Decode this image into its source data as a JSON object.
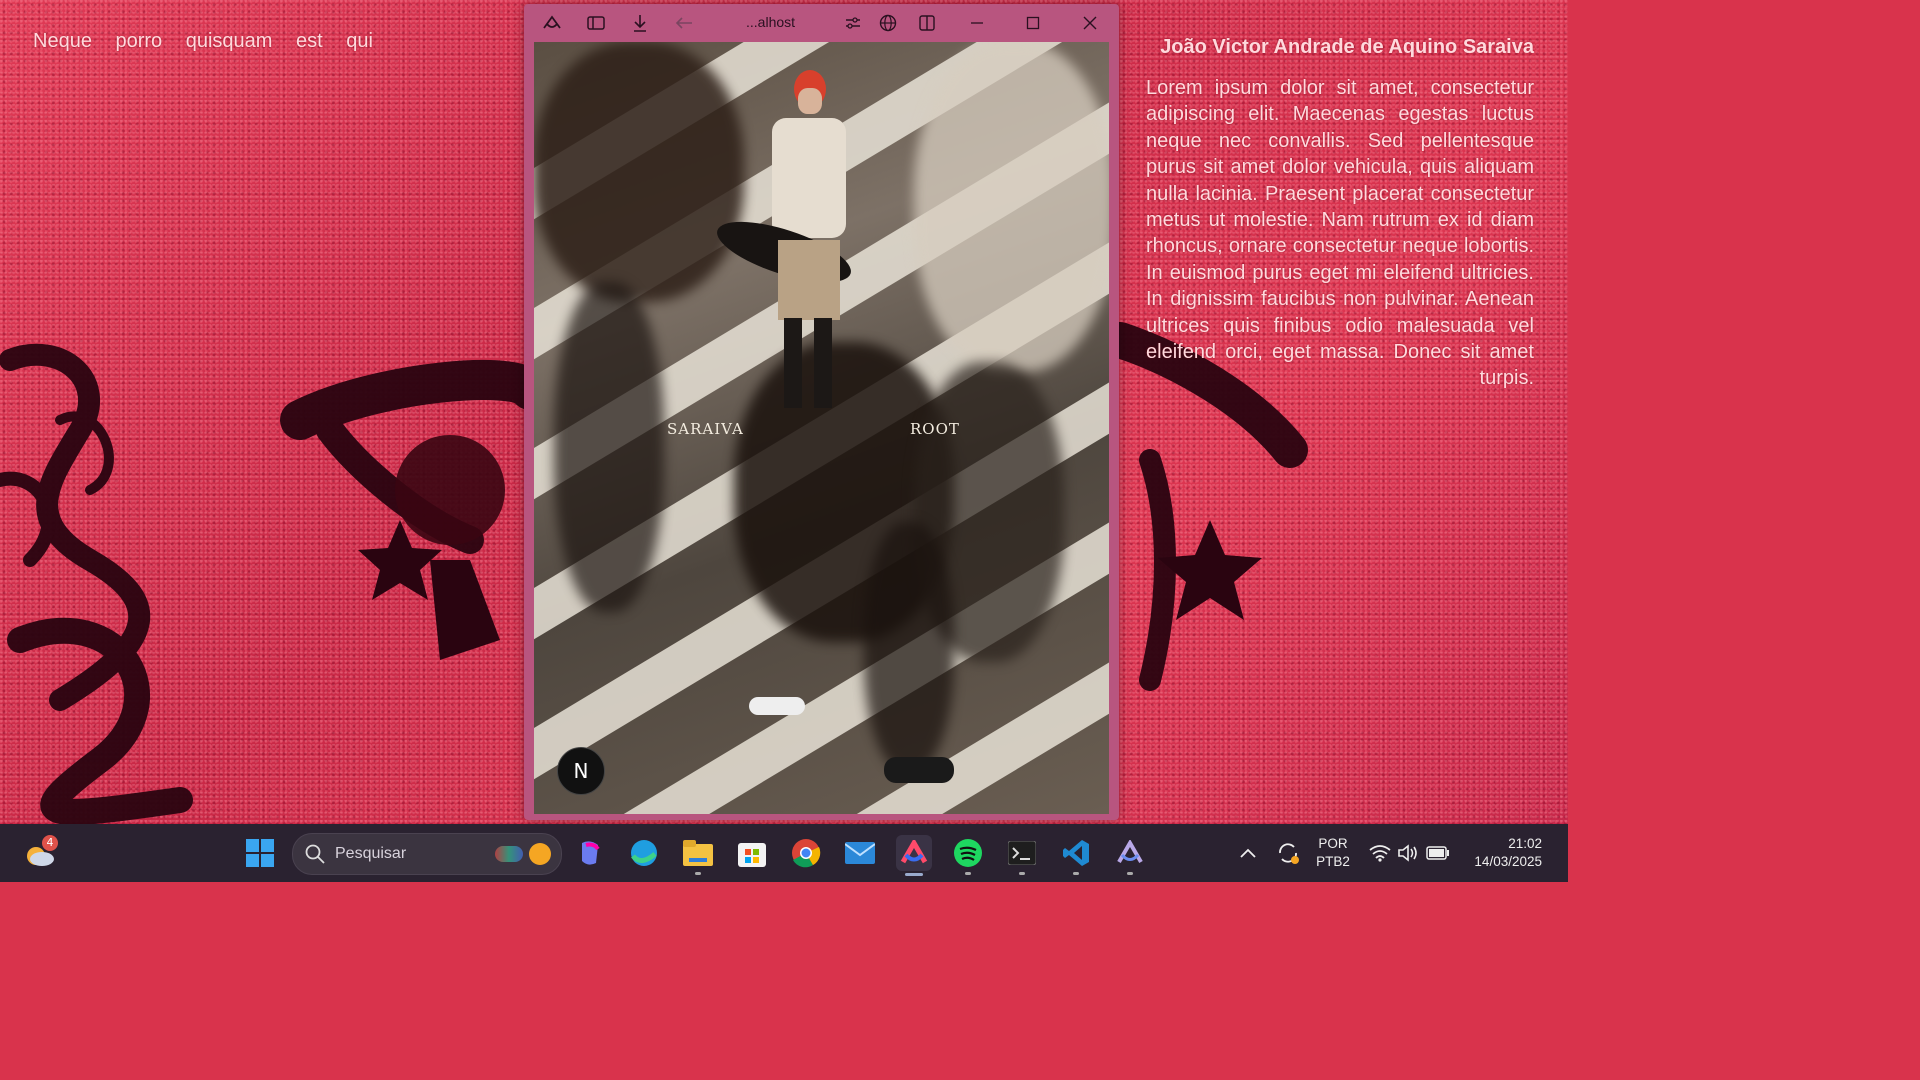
{
  "desktop": {
    "left_text": "Neque porro quisquam est qui",
    "right_title": "João Victor Andrade de Aquino Saraiva",
    "right_body": "Lorem ipsum dolor sit amet, consectetur adipiscing elit. Maecenas egestas luctus neque nec convallis. Sed pellentesque purus sit amet dolor vehicula, quis aliquam nulla lacinia. Praesent placerat consectetur metus ut molestie. Nam rutrum ex id diam rhoncus, ornare consectetur neque lobortis. In euismod purus eget mi eleifend ultricies. In dignissim faucibus non pulvinar. Aenean ultrices quis finibus odio malesuada vel eleifend orci, eget massa. Donec sit amet turpis."
  },
  "browser": {
    "address_title": "...alhost",
    "icons": [
      "arc-logo-icon",
      "sidebar-toggle-icon",
      "download-icon",
      "back-arrow-icon",
      "settings-sliders-icon",
      "globe-icon",
      "split-view-icon",
      "minimize-icon",
      "maximize-icon",
      "close-icon"
    ],
    "page": {
      "caption_left": "SARAIVA",
      "caption_right": "ROOT",
      "badge": "N"
    }
  },
  "taskbar": {
    "weather_badge": "4",
    "search_placeholder": "Pesquisar",
    "apps": [
      "windows-start-icon",
      "copilot-icon",
      "edge-icon",
      "file-explorer-icon",
      "microsoft-store-icon",
      "chrome-icon",
      "mail-icon",
      "arc-browser-icon",
      "spotify-icon",
      "terminal-icon",
      "vscode-icon",
      "arc-alt-icon"
    ],
    "language_line1": "POR",
    "language_line2": "PTB2",
    "time": "21:02",
    "date": "14/03/2025"
  }
}
